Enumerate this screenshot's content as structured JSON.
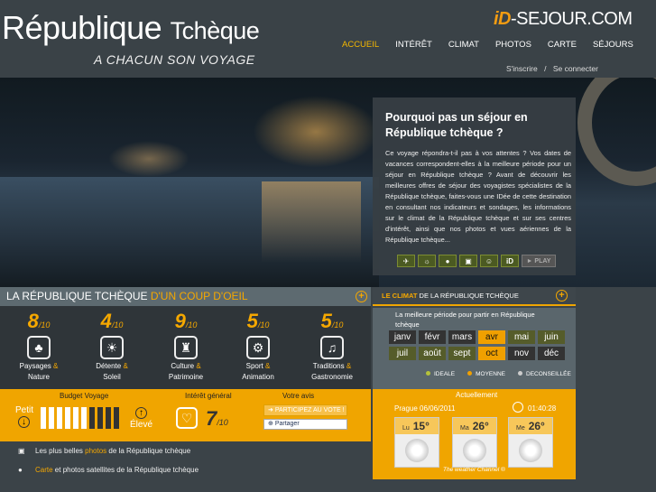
{
  "header": {
    "title_main": "République",
    "title_country": "Tchèque",
    "tagline": "A CHACUN SON VOYAGE",
    "logo_id": "iD",
    "logo_rest": "-SEJOUR.COM",
    "nav": [
      "ACCUEIL",
      "INTÉRÊT",
      "CLIMAT",
      "PHOTOS",
      "CARTE",
      "SÉJOURS"
    ],
    "signup": "S'inscrire",
    "separator": "/",
    "login": "Se connecter"
  },
  "hero": {
    "heading": "Pourquoi pas un séjour en République tchèque ?",
    "text": "Ce voyage répondra-t-il pas à vos attentes ? Vos dates de vacances correspondent-elles à la meilleure période pour un séjour en République tchèque ? Avant de découvrir les meilleures offres de séjour des voyagistes spécialistes de la République tchèque, faites-vous une IDée de cette destination en consultant nos indicateurs et sondages, les informations sur le climat de la République tchèque et sur ses centres d'intérêt, ainsi que nos photos et vues aériennes de la République tchèque...",
    "icons": [
      "plane-icon",
      "sun-icon",
      "balloon-icon",
      "camera-icon",
      "smiley-icon",
      "id-icon"
    ],
    "play_label": "► PLAY"
  },
  "coup": {
    "title_prefix": "LA RÉPUBLIQUE TCHÈQUE",
    "title_highlight": "D'UN COUP D'OEIL",
    "plus": "+",
    "scores": [
      {
        "value": "8",
        "suffix": "/10",
        "label1": "Paysages",
        "amp": "&",
        "label2": "Nature"
      },
      {
        "value": "4",
        "suffix": "/10",
        "label1": "Détente",
        "amp": "&",
        "label2": "Soleil"
      },
      {
        "value": "9",
        "suffix": "/10",
        "label1": "Culture",
        "amp": "&",
        "label2": "Patrimoine"
      },
      {
        "value": "5",
        "suffix": "/10",
        "label1": "Sport",
        "amp": "&",
        "label2": "Animation"
      },
      {
        "value": "5",
        "suffix": "/10",
        "label1": "Traditions",
        "amp": "&",
        "label2": "Gastronomie"
      }
    ]
  },
  "budget": {
    "label": "Budget Voyage",
    "low": "Petit",
    "high": "Élevé",
    "level": 6,
    "total": 10,
    "colors": {
      "filled": "#ffffff",
      "empty": "#333333"
    }
  },
  "interet": {
    "label": "Intérêt général",
    "value": "7",
    "suffix": "/10"
  },
  "avis": {
    "label": "Votre avis",
    "vote": "PARTICIPEZ AU VOTE !",
    "share": "Partager"
  },
  "links": {
    "photos_prefix": "Les plus belles",
    "photos_highlight": "photos",
    "photos_suffix": "de la République tchèque",
    "carte_highlight": "Carte",
    "carte_suffix": "et photos satellites de la République tchèque"
  },
  "climat": {
    "title_highlight": "LE CLIMAT",
    "title_rest": "DE LA RÉPUBLIQUE TCHÈQUE",
    "intro": "La meilleure période pour partir en République tchèque",
    "months": [
      {
        "label": "janv",
        "status": "dec"
      },
      {
        "label": "févr",
        "status": "dec"
      },
      {
        "label": "mars",
        "status": "dec"
      },
      {
        "label": "avr",
        "status": "moy"
      },
      {
        "label": "mai",
        "status": "ideal"
      },
      {
        "label": "juin",
        "status": "ideal"
      },
      {
        "label": "juil",
        "status": "ideal"
      },
      {
        "label": "août",
        "status": "ideal"
      },
      {
        "label": "sept",
        "status": "ideal"
      },
      {
        "label": "oct",
        "status": "moy"
      },
      {
        "label": "nov",
        "status": "dec"
      },
      {
        "label": "déc",
        "status": "dec"
      }
    ],
    "legend": [
      {
        "label": "IDEALE",
        "color": "#b5c23a"
      },
      {
        "label": "MOYENNE",
        "color": "#f0a000"
      },
      {
        "label": "DECONSEILLÉE",
        "color": "#cccccc"
      }
    ]
  },
  "meteo": {
    "title": "Actuellement",
    "city_date": "Prague 06/06/2011",
    "time": "01:40:28",
    "days": [
      {
        "day": "Lu",
        "temp": "15°"
      },
      {
        "day": "Ma",
        "temp": "26°"
      },
      {
        "day": "Me",
        "temp": "26°"
      }
    ],
    "credit": "The weather Channel ®"
  }
}
